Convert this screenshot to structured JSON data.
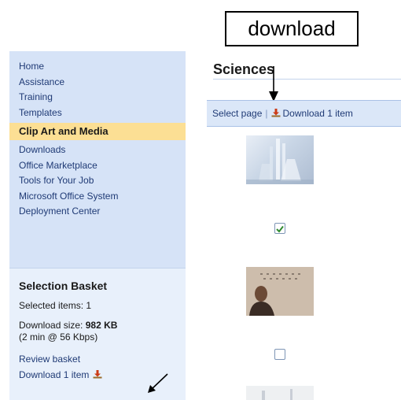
{
  "annotation": {
    "label": "download"
  },
  "sidebar": {
    "nav_items": [
      {
        "label": "Home"
      },
      {
        "label": "Assistance"
      },
      {
        "label": "Training"
      },
      {
        "label": "Templates"
      },
      {
        "label": "Clip Art and Media",
        "active": true
      },
      {
        "label": "Downloads"
      },
      {
        "label": "Office Marketplace"
      },
      {
        "label": "Tools for Your Job"
      },
      {
        "label": "Microsoft Office System"
      },
      {
        "label": "Deployment Center"
      }
    ],
    "basket": {
      "title": "Selection Basket",
      "selected_items": "Selected items: 1",
      "download_size_label": "Download size: ",
      "download_size_value": "982 KB",
      "download_time": "(2 min @ 56 Kbps)",
      "review_link": "Review basket",
      "download_link": "Download 1 item"
    }
  },
  "main": {
    "title": "Sciences",
    "toolbar": {
      "select_page": "Select page",
      "separator": "|",
      "download": "Download 1 item"
    },
    "items": [
      {
        "name": "science-glassware-thumbnail",
        "checked": true
      },
      {
        "name": "person-photo-thumbnail",
        "checked": false
      },
      {
        "name": "third-thumbnail",
        "checked": false
      }
    ]
  },
  "colors": {
    "sidebar_bg": "#d6e3f7",
    "active_bg": "#fcdf94",
    "link": "#1f3a75",
    "download_icon": "#cc3b16",
    "check": "#2f8a2f"
  }
}
